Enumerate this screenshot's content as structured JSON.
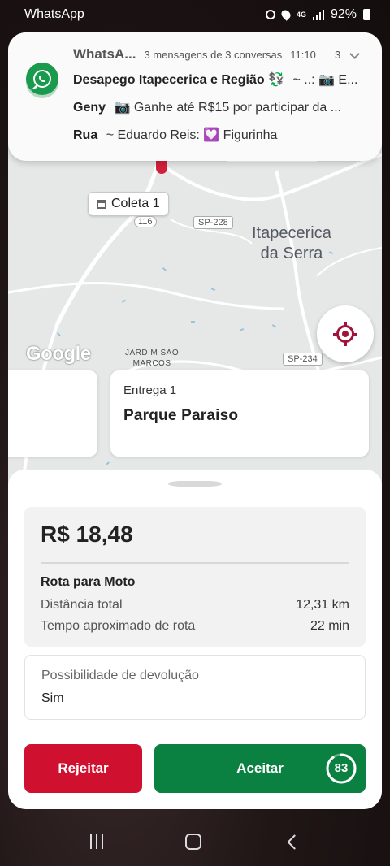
{
  "status_bar": {
    "app_label": "WhatsApp",
    "battery": "92%",
    "network": "4G"
  },
  "notification": {
    "app": "WhatsA...",
    "summary": "3 mensagens de 3 conversas",
    "time": "11:10",
    "count": "3",
    "messages": [
      {
        "sender": "Desapego Itapecerica e Região 💱",
        "text": "~ ..: 📷 E..."
      },
      {
        "sender": "Geny",
        "text": "📷 Ganhe até  R$15 por participar da ..."
      },
      {
        "sender": "Rua",
        "text": "~ Eduardo Reis: 💟 Figurinha"
      }
    ]
  },
  "map": {
    "pickup_chip": "Coleta 1",
    "city": [
      "Itapecerica",
      "da Serra"
    ],
    "district": [
      "JARDIM SAO",
      "MARCOS"
    ],
    "road_tags": [
      "SP-228",
      "SP-234",
      "116"
    ],
    "attribution": "Google"
  },
  "stop_card": {
    "kicker": "Entrega 1",
    "place": "Parque Paraiso"
  },
  "offer": {
    "price": "R$ 18,48",
    "route_title": "Rota para Moto",
    "distance_label": "Distância total",
    "distance_value": "12,31 km",
    "time_label": "Tempo aproximado de rota",
    "time_value": "22 min",
    "return_label": "Possibilidade de devolução",
    "return_value": "Sim"
  },
  "actions": {
    "reject": "Rejeitar",
    "accept": "Aceitar",
    "countdown": "83",
    "countdown_progress": 0.9
  },
  "colors": {
    "accent_red": "#d0102f",
    "accent_green": "#0a8140",
    "whatsapp_green": "#1a9a4c"
  }
}
